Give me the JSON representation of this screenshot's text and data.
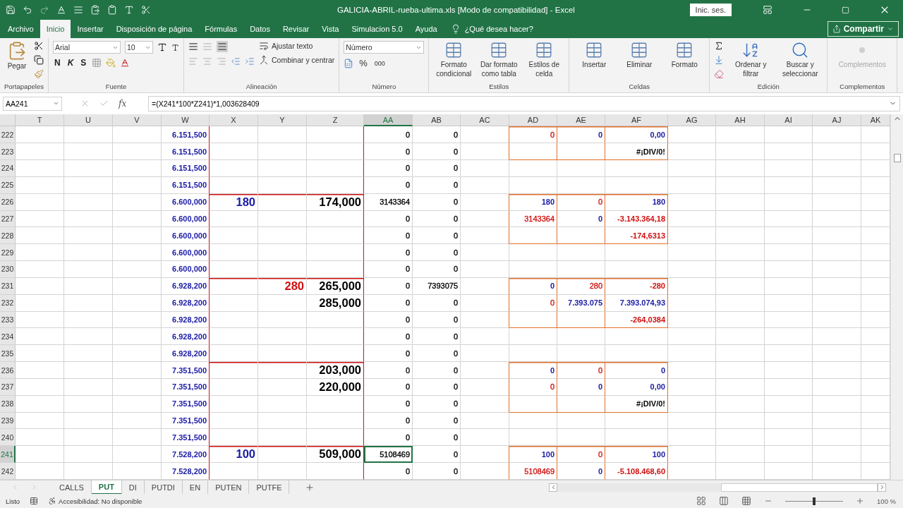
{
  "window": {
    "title": "GALICIA-ABRIL-rueba-ultima.xls  [Modo de compatibilidad]  -  Excel",
    "signin": "Inic. ses."
  },
  "menu_tabs": [
    {
      "label": "Archivo",
      "selected": false
    },
    {
      "label": "Inicio",
      "selected": true
    },
    {
      "label": "Insertar",
      "selected": false
    },
    {
      "label": "Disposición de página",
      "selected": false
    },
    {
      "label": "Fórmulas",
      "selected": false
    },
    {
      "label": "Datos",
      "selected": false
    },
    {
      "label": "Revisar",
      "selected": false
    },
    {
      "label": "Vista",
      "selected": false
    },
    {
      "label": "Simulacion 5.0",
      "selected": false
    },
    {
      "label": "Ayuda",
      "selected": false
    }
  ],
  "tell_me": "¿Qué desea hacer?",
  "share": "Compartir",
  "ribbon": [
    {
      "kind": "clipboard",
      "name": "Portapapeles",
      "paste": "Pegar"
    },
    {
      "kind": "font",
      "name": "Fuente",
      "font": "Arial",
      "size": "10",
      "styles": [
        "N",
        "K",
        "S"
      ]
    },
    {
      "kind": "align",
      "name": "Alineación",
      "wrap": "Ajustar texto",
      "merge": "Combinar y centrar"
    },
    {
      "kind": "number",
      "name": "Número",
      "format": "Número",
      "symbols": [
        "%",
        "000"
      ]
    },
    {
      "kind": "buttons",
      "name": "Estilos",
      "buttons": [
        {
          "label": "Formato condicional",
          "disabled": false
        },
        {
          "label": "Dar formato como tabla",
          "disabled": false
        },
        {
          "label": "Estilos de celda",
          "disabled": false
        }
      ]
    },
    {
      "kind": "buttons",
      "name": "Celdas",
      "buttons": [
        {
          "label": "Insertar",
          "disabled": false
        },
        {
          "label": "Eliminar",
          "disabled": false
        },
        {
          "label": "Formato",
          "disabled": false
        }
      ]
    },
    {
      "kind": "edit",
      "name": "Edición",
      "buttons": [
        {
          "label": "Ordenar y filtrar",
          "disabled": false
        },
        {
          "label": "Buscar y seleccionar",
          "disabled": false
        }
      ]
    },
    {
      "kind": "buttons",
      "name": "Complementos",
      "buttons": [
        {
          "label": "Complementos",
          "disabled": true
        }
      ]
    }
  ],
  "formula_bar": {
    "name_box": "AA241",
    "fx": "fx",
    "formula": "=(X241*100*Z241)*1,003628409"
  },
  "columns": [
    {
      "label": "T",
      "selected": false
    },
    {
      "label": "U",
      "selected": false
    },
    {
      "label": "V",
      "selected": false
    },
    {
      "label": "W",
      "selected": false
    },
    {
      "label": "X",
      "selected": false
    },
    {
      "label": "Y",
      "selected": false
    },
    {
      "label": "Z",
      "selected": false
    },
    {
      "label": "AA",
      "selected": true
    },
    {
      "label": "AB",
      "selected": false
    },
    {
      "label": "AC",
      "selected": false
    },
    {
      "label": "AD",
      "selected": false
    },
    {
      "label": "AE",
      "selected": false
    },
    {
      "label": "AF",
      "selected": false
    },
    {
      "label": "AG",
      "selected": false
    },
    {
      "label": "AH",
      "selected": false
    },
    {
      "label": "AI",
      "selected": false
    },
    {
      "label": "AJ",
      "selected": false
    },
    {
      "label": "AK",
      "selected": false
    }
  ],
  "rows": [
    {
      "label": "222",
      "selected": false,
      "divider": false,
      "boxed": true,
      "box_top": true,
      "box_bottom": false,
      "cells": [
        {},
        {},
        {},
        {
          "text": "6.151,500",
          "kind": "bold",
          "color": "#1a1aa6"
        },
        {},
        {},
        {},
        {
          "text": "0",
          "kind": "normal"
        },
        {
          "text": "0",
          "kind": "normal"
        },
        {},
        {
          "text": "0",
          "kind": "normal",
          "color": "#d01010"
        },
        {
          "text": "0",
          "kind": "bold",
          "color": "#1a1aa6"
        },
        {
          "text": "0,00",
          "kind": "bold",
          "color": "#1a1aa6"
        },
        {},
        {},
        {},
        {},
        {}
      ]
    },
    {
      "label": "223",
      "selected": false,
      "divider": false,
      "boxed": true,
      "box_top": false,
      "box_bottom": true,
      "cells": [
        {},
        {},
        {},
        {
          "text": "6.151,500",
          "kind": "bold",
          "color": "#1a1aa6"
        },
        {},
        {},
        {},
        {
          "text": "0",
          "kind": "normal"
        },
        {
          "text": "0",
          "kind": "normal"
        },
        {},
        {},
        {},
        {
          "text": "#¡DIV/0!",
          "kind": "bold"
        },
        {},
        {},
        {},
        {},
        {}
      ]
    },
    {
      "label": "224",
      "selected": false,
      "divider": false,
      "boxed": false,
      "box_top": false,
      "box_bottom": false,
      "cells": [
        {},
        {},
        {},
        {
          "text": "6.151,500",
          "kind": "bold",
          "color": "#1a1aa6"
        },
        {},
        {},
        {},
        {
          "text": "0",
          "kind": "normal"
        },
        {
          "text": "0",
          "kind": "normal"
        },
        {},
        {},
        {},
        {},
        {},
        {},
        {},
        {},
        {}
      ]
    },
    {
      "label": "225",
      "selected": false,
      "divider": false,
      "boxed": false,
      "box_top": false,
      "box_bottom": false,
      "cells": [
        {},
        {},
        {},
        {
          "text": "6.151,500",
          "kind": "bold",
          "color": "#1a1aa6"
        },
        {},
        {},
        {},
        {
          "text": "0",
          "kind": "normal"
        },
        {
          "text": "0",
          "kind": "normal"
        },
        {},
        {},
        {},
        {},
        {},
        {},
        {},
        {},
        {}
      ]
    },
    {
      "label": "226",
      "selected": false,
      "divider": true,
      "boxed": true,
      "box_top": true,
      "box_bottom": false,
      "cells": [
        {},
        {},
        {},
        {
          "text": "6.600,000",
          "kind": "bold",
          "color": "#1a1aa6"
        },
        {
          "text": "180",
          "kind": "big",
          "color": "#1a1aa6"
        },
        {},
        {
          "text": "174,000",
          "kind": "big"
        },
        {
          "text": "3143364",
          "kind": "normal"
        },
        {
          "text": "0",
          "kind": "normal"
        },
        {},
        {
          "text": "180",
          "kind": "bold",
          "color": "#1a1aa6"
        },
        {
          "text": "0",
          "kind": "normal",
          "color": "#d01010"
        },
        {
          "text": "180",
          "kind": "bold",
          "color": "#1a1aa6"
        },
        {},
        {},
        {},
        {},
        {}
      ]
    },
    {
      "label": "227",
      "selected": false,
      "divider": false,
      "boxed": true,
      "box_top": false,
      "box_bottom": false,
      "cells": [
        {},
        {},
        {},
        {
          "text": "6.600,000",
          "kind": "bold",
          "color": "#1a1aa6"
        },
        {},
        {},
        {},
        {
          "text": "0",
          "kind": "normal"
        },
        {
          "text": "0",
          "kind": "normal"
        },
        {},
        {
          "text": "3143364",
          "kind": "normal",
          "color": "#d01010"
        },
        {
          "text": "0",
          "kind": "bold",
          "color": "#1a1aa6"
        },
        {
          "text": "-3.143.364,18",
          "kind": "bold",
          "color": "#d01010"
        },
        {},
        {},
        {},
        {},
        {}
      ]
    },
    {
      "label": "228",
      "selected": false,
      "divider": false,
      "boxed": true,
      "box_top": false,
      "box_bottom": true,
      "cells": [
        {},
        {},
        {},
        {
          "text": "6.600,000",
          "kind": "bold",
          "color": "#1a1aa6"
        },
        {},
        {},
        {},
        {
          "text": "0",
          "kind": "normal"
        },
        {
          "text": "0",
          "kind": "normal"
        },
        {},
        {},
        {},
        {
          "text": "-174,6313",
          "kind": "bold",
          "color": "#d01010"
        },
        {},
        {},
        {},
        {},
        {}
      ]
    },
    {
      "label": "229",
      "selected": false,
      "divider": false,
      "boxed": false,
      "box_top": false,
      "box_bottom": false,
      "cells": [
        {},
        {},
        {},
        {
          "text": "6.600,000",
          "kind": "bold",
          "color": "#1a1aa6"
        },
        {},
        {},
        {},
        {
          "text": "0",
          "kind": "normal"
        },
        {
          "text": "0",
          "kind": "normal"
        },
        {},
        {},
        {},
        {},
        {},
        {},
        {},
        {},
        {}
      ]
    },
    {
      "label": "230",
      "selected": false,
      "divider": false,
      "boxed": false,
      "box_top": false,
      "box_bottom": false,
      "cells": [
        {},
        {},
        {},
        {
          "text": "6.600,000",
          "kind": "bold",
          "color": "#1a1aa6"
        },
        {},
        {},
        {},
        {
          "text": "0",
          "kind": "normal"
        },
        {
          "text": "0",
          "kind": "normal"
        },
        {},
        {},
        {},
        {},
        {},
        {},
        {},
        {},
        {}
      ]
    },
    {
      "label": "231",
      "selected": false,
      "divider": true,
      "boxed": true,
      "box_top": true,
      "box_bottom": false,
      "cells": [
        {},
        {},
        {},
        {
          "text": "6.928,200",
          "kind": "bold",
          "color": "#1a1aa6"
        },
        {},
        {
          "text": "280",
          "kind": "big",
          "color": "#d01010"
        },
        {
          "text": "265,000",
          "kind": "big"
        },
        {
          "text": "0",
          "kind": "normal"
        },
        {
          "text": "7393075",
          "kind": "normal"
        },
        {},
        {
          "text": "0",
          "kind": "bold",
          "color": "#1a1aa6"
        },
        {
          "text": "280",
          "kind": "normal",
          "color": "#d01010"
        },
        {
          "text": "-280",
          "kind": "bold",
          "color": "#d01010"
        },
        {},
        {},
        {},
        {},
        {}
      ]
    },
    {
      "label": "232",
      "selected": false,
      "divider": false,
      "boxed": true,
      "box_top": false,
      "box_bottom": false,
      "cells": [
        {},
        {},
        {},
        {
          "text": "6.928,200",
          "kind": "bold",
          "color": "#1a1aa6"
        },
        {},
        {},
        {
          "text": "285,000",
          "kind": "big"
        },
        {
          "text": "0",
          "kind": "normal"
        },
        {
          "text": "0",
          "kind": "normal"
        },
        {},
        {
          "text": "0",
          "kind": "normal",
          "color": "#d01010"
        },
        {
          "text": "7.393.075",
          "kind": "bold",
          "color": "#1a1aa6"
        },
        {
          "text": "7.393.074,93",
          "kind": "bold",
          "color": "#1a1aa6"
        },
        {},
        {},
        {},
        {},
        {}
      ]
    },
    {
      "label": "233",
      "selected": false,
      "divider": false,
      "boxed": true,
      "box_top": false,
      "box_bottom": true,
      "cells": [
        {},
        {},
        {},
        {
          "text": "6.928,200",
          "kind": "bold",
          "color": "#1a1aa6"
        },
        {},
        {},
        {},
        {
          "text": "0",
          "kind": "normal"
        },
        {
          "text": "0",
          "kind": "normal"
        },
        {},
        {},
        {},
        {
          "text": "-264,0384",
          "kind": "bold",
          "color": "#d01010"
        },
        {},
        {},
        {},
        {},
        {}
      ]
    },
    {
      "label": "234",
      "selected": false,
      "divider": false,
      "boxed": false,
      "box_top": false,
      "box_bottom": false,
      "cells": [
        {},
        {},
        {},
        {
          "text": "6.928,200",
          "kind": "bold",
          "color": "#1a1aa6"
        },
        {},
        {},
        {},
        {
          "text": "0",
          "kind": "normal"
        },
        {
          "text": "0",
          "kind": "normal"
        },
        {},
        {},
        {},
        {},
        {},
        {},
        {},
        {},
        {}
      ]
    },
    {
      "label": "235",
      "selected": false,
      "divider": false,
      "boxed": false,
      "box_top": false,
      "box_bottom": false,
      "cells": [
        {},
        {},
        {},
        {
          "text": "6.928,200",
          "kind": "bold",
          "color": "#1a1aa6"
        },
        {},
        {},
        {},
        {
          "text": "0",
          "kind": "normal"
        },
        {
          "text": "0",
          "kind": "normal"
        },
        {},
        {},
        {},
        {},
        {},
        {},
        {},
        {},
        {}
      ]
    },
    {
      "label": "236",
      "selected": false,
      "divider": true,
      "boxed": true,
      "box_top": true,
      "box_bottom": false,
      "cells": [
        {},
        {},
        {},
        {
          "text": "7.351,500",
          "kind": "bold",
          "color": "#1a1aa6"
        },
        {},
        {},
        {
          "text": "203,000",
          "kind": "big"
        },
        {
          "text": "0",
          "kind": "normal"
        },
        {
          "text": "0",
          "kind": "normal"
        },
        {},
        {
          "text": "0",
          "kind": "bold",
          "color": "#1a1aa6"
        },
        {
          "text": "0",
          "kind": "normal",
          "color": "#d01010"
        },
        {
          "text": "0",
          "kind": "bold",
          "color": "#1a1aa6"
        },
        {},
        {},
        {},
        {},
        {}
      ]
    },
    {
      "label": "237",
      "selected": false,
      "divider": false,
      "boxed": true,
      "box_top": false,
      "box_bottom": false,
      "cells": [
        {},
        {},
        {},
        {
          "text": "7.351,500",
          "kind": "bold",
          "color": "#1a1aa6"
        },
        {},
        {},
        {
          "text": "220,000",
          "kind": "big"
        },
        {
          "text": "0",
          "kind": "normal"
        },
        {
          "text": "0",
          "kind": "normal"
        },
        {},
        {
          "text": "0",
          "kind": "normal",
          "color": "#d01010"
        },
        {
          "text": "0",
          "kind": "bold",
          "color": "#1a1aa6"
        },
        {
          "text": "0,00",
          "kind": "bold",
          "color": "#1a1aa6"
        },
        {},
        {},
        {},
        {},
        {}
      ]
    },
    {
      "label": "238",
      "selected": false,
      "divider": false,
      "boxed": true,
      "box_top": false,
      "box_bottom": true,
      "cells": [
        {},
        {},
        {},
        {
          "text": "7.351,500",
          "kind": "bold",
          "color": "#1a1aa6"
        },
        {},
        {},
        {},
        {
          "text": "0",
          "kind": "normal"
        },
        {
          "text": "0",
          "kind": "normal"
        },
        {},
        {},
        {},
        {
          "text": "#¡DIV/0!",
          "kind": "bold"
        },
        {},
        {},
        {},
        {},
        {}
      ]
    },
    {
      "label": "239",
      "selected": false,
      "divider": false,
      "boxed": false,
      "box_top": false,
      "box_bottom": false,
      "cells": [
        {},
        {},
        {},
        {
          "text": "7.351,500",
          "kind": "bold",
          "color": "#1a1aa6"
        },
        {},
        {},
        {},
        {
          "text": "0",
          "kind": "normal"
        },
        {
          "text": "0",
          "kind": "normal"
        },
        {},
        {},
        {},
        {},
        {},
        {},
        {},
        {},
        {}
      ]
    },
    {
      "label": "240",
      "selected": false,
      "divider": false,
      "boxed": false,
      "box_top": false,
      "box_bottom": false,
      "cells": [
        {},
        {},
        {},
        {
          "text": "7.351,500",
          "kind": "bold",
          "color": "#1a1aa6"
        },
        {},
        {},
        {},
        {
          "text": "0",
          "kind": "normal"
        },
        {
          "text": "0",
          "kind": "normal"
        },
        {},
        {},
        {},
        {},
        {},
        {},
        {},
        {},
        {}
      ]
    },
    {
      "label": "241",
      "selected": true,
      "divider": true,
      "boxed": true,
      "box_top": true,
      "box_bottom": false,
      "cells": [
        {},
        {},
        {},
        {
          "text": "7.528,200",
          "kind": "bold",
          "color": "#1a1aa6"
        },
        {
          "text": "100",
          "kind": "big",
          "color": "#1a1aa6"
        },
        {},
        {
          "text": "509,000",
          "kind": "big"
        },
        {
          "text": "5108469",
          "kind": "normal",
          "selected": true
        },
        {
          "text": "0",
          "kind": "normal"
        },
        {},
        {
          "text": "100",
          "kind": "bold",
          "color": "#1a1aa6"
        },
        {
          "text": "0",
          "kind": "normal",
          "color": "#d01010"
        },
        {
          "text": "100",
          "kind": "bold",
          "color": "#1a1aa6"
        },
        {},
        {},
        {},
        {},
        {}
      ]
    },
    {
      "label": "242",
      "selected": false,
      "divider": false,
      "boxed": true,
      "box_top": false,
      "box_bottom": false,
      "cells": [
        {},
        {},
        {},
        {
          "text": "7.528,200",
          "kind": "bold",
          "color": "#1a1aa6"
        },
        {},
        {},
        {},
        {
          "text": "0",
          "kind": "normal"
        },
        {
          "text": "0",
          "kind": "normal"
        },
        {},
        {
          "text": "5108469",
          "kind": "normal",
          "color": "#d01010"
        },
        {
          "text": "0",
          "kind": "bold",
          "color": "#1a1aa6"
        },
        {
          "text": "-5.108.468,60",
          "kind": "bold",
          "color": "#d01010"
        },
        {},
        {},
        {},
        {},
        {}
      ]
    }
  ],
  "sheets": [
    {
      "label": "CALLS",
      "selected": false
    },
    {
      "label": "PUT",
      "selected": true
    },
    {
      "label": "DI",
      "selected": false
    },
    {
      "label": "PUTDI",
      "selected": false
    },
    {
      "label": "EN",
      "selected": false
    },
    {
      "label": "PUTEN",
      "selected": false
    },
    {
      "label": "PUTFE",
      "selected": false
    }
  ],
  "status_bar": {
    "mode": "Listo",
    "accessibility": "Accesibilidad: No disponible",
    "zoom": "100 %",
    "zoom_slider": {
      "level": 0.5
    }
  }
}
